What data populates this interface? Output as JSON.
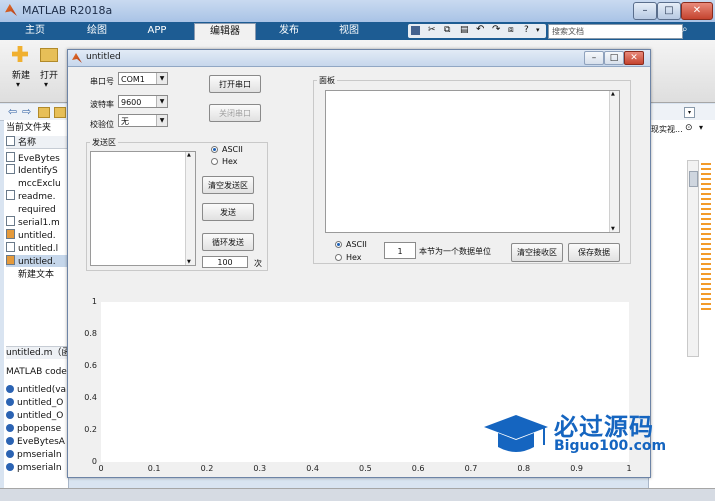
{
  "app": {
    "title": "MATLAB R2018a",
    "tabs": [
      {
        "label": "主页"
      },
      {
        "label": "绘图"
      },
      {
        "label": "APP"
      },
      {
        "label": "编辑器",
        "active": true
      },
      {
        "label": "发布"
      },
      {
        "label": "视图"
      }
    ],
    "search_placeholder": "搜索文档",
    "ribbon": {
      "new_label": "新建",
      "open_label": "打开"
    },
    "current_folder_label": "当前文件夹",
    "name_column": "名称",
    "files": [
      "EveBytes",
      "IdentifyS",
      "mccExclu",
      "readme.",
      "required",
      "serial1.m",
      "untitled.",
      "untitled.l",
      "untitled.",
      "新建文本"
    ],
    "detail_title": "untitled.m（函",
    "detail_label": "MATLAB code",
    "functions": [
      "untitled(va",
      "untitled_O",
      "untitled_O",
      "pbopense",
      "EveBytesA",
      "pmserialn",
      "pmserialn"
    ],
    "right_hint": "现实视..."
  },
  "figure": {
    "title": "untitled",
    "controls": {
      "port_label": "串口号",
      "port_value": "COM1",
      "baud_label": "波特率",
      "baud_value": "9600",
      "parity_label": "校验位",
      "parity_value": "无",
      "open_port_button": "打开串口",
      "close_port_button": "关闭串口"
    },
    "send_panel": {
      "title": "发送区",
      "ascii_label": "ASCII",
      "hex_label": "Hex",
      "clear_button": "清空发送区",
      "send_button": "发送",
      "loop_button": "循环发送",
      "count_value": "100",
      "count_unit": "次"
    },
    "receive_panel": {
      "title": "面板",
      "ascii_label": "ASCII",
      "hex_label": "Hex",
      "bytes_value": "1",
      "bytes_label": "本节为一个数据单位",
      "clear_button": "清空接收区",
      "save_button": "保存数据"
    },
    "plot": {
      "x_ticks": [
        "0",
        "0.1",
        "0.2",
        "0.3",
        "0.4",
        "0.5",
        "0.6",
        "0.7",
        "0.8",
        "0.9",
        "1"
      ],
      "y_ticks": [
        "0",
        "0.2",
        "0.4",
        "0.6",
        "0.8",
        "1"
      ]
    }
  },
  "watermark": {
    "cn": "必过源码",
    "en": "Biguo100.com"
  },
  "colors": {
    "tab_bar": "#1d5c93",
    "accent": "#1c5fb5",
    "logo_blue": "#1565c0"
  }
}
